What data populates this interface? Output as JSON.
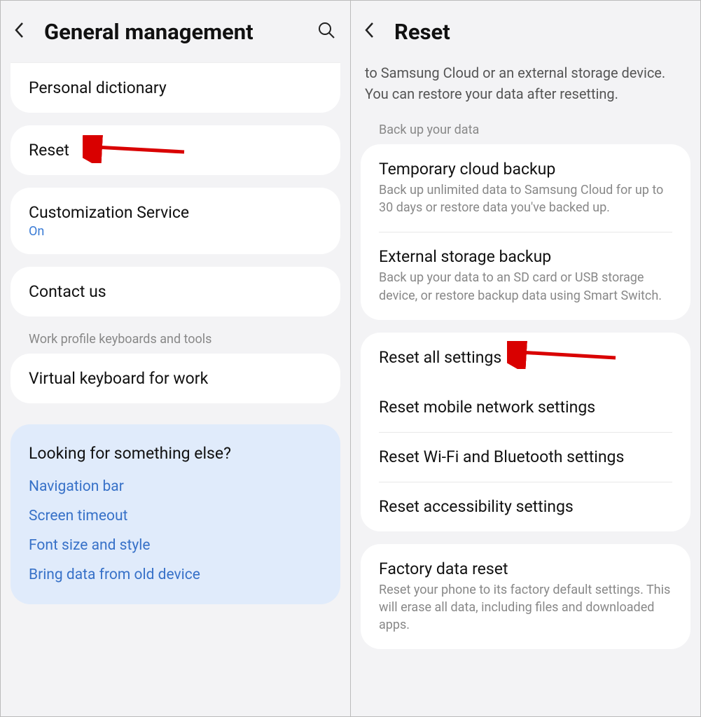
{
  "left": {
    "title": "General management",
    "group1": {
      "personal_dictionary": "Personal dictionary"
    },
    "group2": {
      "reset": "Reset"
    },
    "group3": {
      "customization_service": "Customization Service",
      "customization_value": "On"
    },
    "group4": {
      "contact_us": "Contact us"
    },
    "section_label": "Work profile keyboards and tools",
    "group5": {
      "virtual_keyboard": "Virtual keyboard for work"
    },
    "suggest": {
      "title": "Looking for something else?",
      "links": [
        "Navigation bar",
        "Screen timeout",
        "Font size and style",
        "Bring data from old device"
      ]
    }
  },
  "right": {
    "title": "Reset",
    "intro": "to Samsung Cloud or an external storage device. You can restore your data after resetting.",
    "section_label": "Back up your data",
    "backup": {
      "temp_cloud_title": "Temporary cloud backup",
      "temp_cloud_desc": "Back up unlimited data to Samsung Cloud for up to 30 days or restore data you've backed up.",
      "ext_storage_title": "External storage backup",
      "ext_storage_desc": "Back up your data to an SD card or USB storage device, or restore backup data using Smart Switch."
    },
    "resets": {
      "all": "Reset all settings",
      "mobile": "Reset mobile network settings",
      "wifi_bt": "Reset Wi-Fi and Bluetooth settings",
      "accessibility": "Reset accessibility settings"
    },
    "factory": {
      "title": "Factory data reset",
      "desc": "Reset your phone to its factory default settings. This will erase all data, including files and downloaded apps."
    }
  }
}
